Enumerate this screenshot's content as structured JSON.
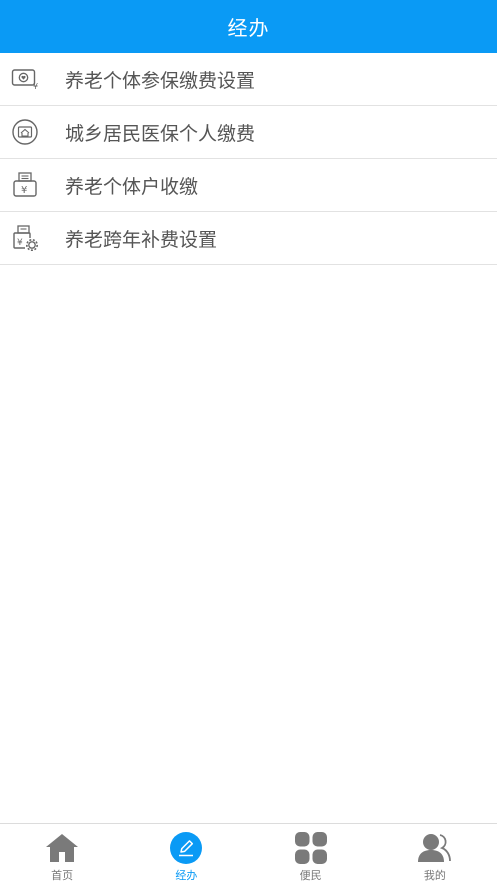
{
  "header": {
    "title": "经办"
  },
  "menu": {
    "items": [
      {
        "label": "养老个体参保缴费设置",
        "icon": "pension-payment-settings-icon"
      },
      {
        "label": "城乡居民医保个人缴费",
        "icon": "medical-insurance-house-icon"
      },
      {
        "label": "养老个体户收缴",
        "icon": "yuan-register-icon"
      },
      {
        "label": "养老跨年补费设置",
        "icon": "register-gear-icon"
      }
    ]
  },
  "tabbar": {
    "active_color": "#0a9af5",
    "inactive_color": "#777777",
    "tabs": [
      {
        "label": "首页",
        "icon": "home-icon"
      },
      {
        "label": "经办",
        "icon": "edit-icon"
      },
      {
        "label": "便民",
        "icon": "grid-icon"
      },
      {
        "label": "我的",
        "icon": "user-icon"
      }
    ]
  }
}
